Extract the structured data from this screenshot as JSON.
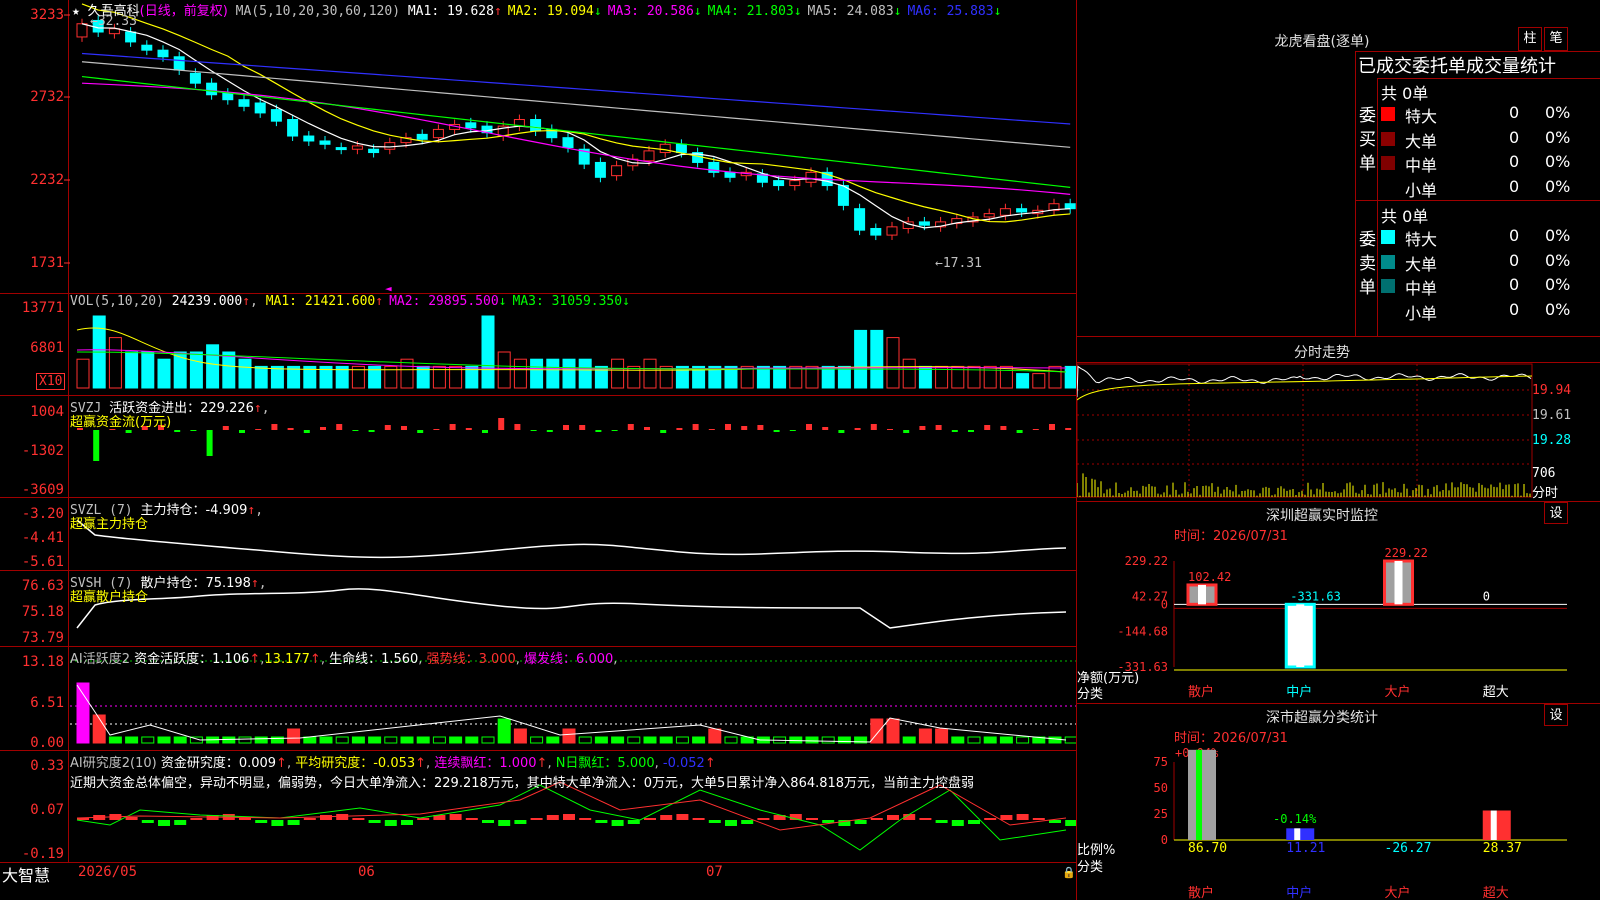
{
  "window": {
    "app_name": "大智慧"
  },
  "kline": {
    "stock_name": "久吾高科",
    "period": "(日线，前复权)",
    "ma_label": "MA(5,10,20,30,60,120)",
    "ma": [
      {
        "name": "MA1",
        "value": "19.628",
        "arrow": "↑",
        "color": "#ffffff"
      },
      {
        "name": "MA2",
        "value": "19.094",
        "arrow": "↓",
        "color": "#ffff00"
      },
      {
        "name": "MA3",
        "value": "20.586",
        "arrow": "↓",
        "color": "#ff00ff"
      },
      {
        "name": "MA4",
        "value": "21.803",
        "arrow": "↓",
        "color": "#00ff00"
      },
      {
        "name": "MA5",
        "value": "24.083",
        "arrow": "↓",
        "color": "#c0c0c0"
      },
      {
        "name": "MA6",
        "value": "25.883",
        "arrow": "↓",
        "color": "#3030ff"
      }
    ],
    "y_ticks": [
      "3233",
      "2732",
      "2232",
      "1731"
    ],
    "high_mark": "32.33",
    "low_mark": "←17.31"
  },
  "volume": {
    "label": "VOL(5,10,20)",
    "value": "24239.000",
    "ma": [
      {
        "name": "MA1",
        "value": "21421.600",
        "arrow": "↑",
        "color": "#ffff00"
      },
      {
        "name": "MA2",
        "value": "29895.500",
        "arrow": "↓",
        "color": "#ff00ff"
      },
      {
        "name": "MA3",
        "value": "31059.350",
        "arrow": "↓",
        "color": "#00ff00"
      }
    ],
    "y_ticks": [
      "13771",
      "6801"
    ],
    "unit": "X10"
  },
  "svzj": {
    "label": "SVZJ",
    "text": "活跃资金进出：229.226",
    "sub": "超赢资金流(万元)",
    "y_ticks": [
      "1004",
      "-1302",
      "-3609"
    ]
  },
  "svzl": {
    "label": "SVZL (7)",
    "text": "主力持仓：-4.909",
    "sub": "超赢主力持仓",
    "y_ticks": [
      "-3.20",
      "-4.41",
      "-5.61"
    ]
  },
  "svsh": {
    "label": "SVSH (7)",
    "text": "散户持仓：75.198",
    "sub": "超赢散户持仓",
    "y_ticks": [
      "76.63",
      "75.18",
      "73.79"
    ]
  },
  "ai1": {
    "label": "AI活跃度2",
    "text": "资金活跃度：1.106",
    "v2": "13.177",
    "life": "生命线：1.560",
    "strong": "强势线：3.000",
    "burst": "爆发线：6.000",
    "y_ticks": [
      "13.18",
      "6.51",
      "0.00"
    ]
  },
  "ai2": {
    "label": "AI研究度2(10)",
    "text": "资金研究度：0.009",
    "avg": "平均研究度：-0.053",
    "cont": "连续飘红：1.000",
    "nday": "N日飘红：5.000",
    "last": "-0.052",
    "comment": "近期大资金总体偏空，异动不明显，偏弱势，今日大单净流入：229.218万元，其中特大单净流入：0万元，大单5日累计净入864.818万元，当前主力控盘弱",
    "y_ticks": [
      "0.33",
      "0.07",
      "-0.19"
    ]
  },
  "x_axis": [
    "2026/05",
    "06",
    "07"
  ],
  "right": {
    "longhu": {
      "title": "龙虎看盘(逐单)",
      "btn1": "柱",
      "btn2": "笔",
      "header": "已成交委托单成交量统计",
      "buy_label": "委买单",
      "sell_label": "委卖单",
      "buy_total": "共 0单",
      "sell_total": "共 0单",
      "rows_buy": [
        {
          "name": "特大",
          "count": "0",
          "pct": "0%",
          "color": "#ff0000"
        },
        {
          "name": "大单",
          "count": "0",
          "pct": "0%",
          "color": "#8b0000"
        },
        {
          "name": "中单",
          "count": "0",
          "pct": "0%",
          "color": "#800000"
        },
        {
          "name": "小单",
          "count": "0",
          "pct": "0%",
          "color": "#000000"
        }
      ],
      "rows_sell": [
        {
          "name": "特大",
          "count": "0",
          "pct": "0%",
          "color": "#00ffff"
        },
        {
          "name": "大单",
          "count": "0",
          "pct": "0%",
          "color": "#008b8b"
        },
        {
          "name": "中单",
          "count": "0",
          "pct": "0%",
          "color": "#007070"
        },
        {
          "name": "小单",
          "count": "0",
          "pct": "0%",
          "color": "#000000"
        }
      ]
    },
    "fenshi": {
      "title": "分时走势",
      "y1": "19.94",
      "y2": "19.61",
      "y3": "19.28",
      "vol": "706",
      "vol_label": "分时"
    },
    "monitor": {
      "title": "深圳超赢实时监控",
      "btn": "设",
      "time": "时间：2026/07/31",
      "y_ticks": [
        "229.22",
        "42.27",
        "0",
        "-144.68",
        "-331.63"
      ],
      "ylabel": "净额(万元)",
      "xlabel": "分类",
      "bars": [
        {
          "cat": "散户",
          "value": 102.42,
          "label": "102.42"
        },
        {
          "cat": "中户",
          "value": -331.63,
          "label": "-331.63"
        },
        {
          "cat": "大户",
          "value": 229.22,
          "label": "229.22"
        },
        {
          "cat": "超大",
          "value": 0,
          "label": "0"
        }
      ]
    },
    "classify": {
      "title": "深市超赢分类统计",
      "btn": "设",
      "time": "时间：2026/07/31",
      "y_ticks": [
        "75",
        "50",
        "25",
        "0"
      ],
      "ylabel": "比例%",
      "xlabel": "分类",
      "top_label1": "+0.04%",
      "top_label2": "-0.14%",
      "bars": [
        {
          "cat": "散户",
          "value": 86.7,
          "label": "86.70"
        },
        {
          "cat": "中户",
          "value": 11.21,
          "label": "11.21"
        },
        {
          "cat": "大户",
          "value": -26.27,
          "label": "-26.27"
        },
        {
          "cat": "超大",
          "value": 28.37,
          "label": "28.37"
        }
      ]
    }
  },
  "chart_data": [
    {
      "type": "bar",
      "title": "深圳超赢实时监控",
      "categories": [
        "散户",
        "中户",
        "大户",
        "超大"
      ],
      "values": [
        102.42,
        -331.63,
        229.22,
        0
      ],
      "ylabel": "净额(万元)",
      "xlabel": "分类",
      "ylim": [
        -331.63,
        229.22
      ]
    },
    {
      "type": "bar",
      "title": "深市超赢分类统计",
      "categories": [
        "散户",
        "中户",
        "大户",
        "超大"
      ],
      "values": [
        86.7,
        11.21,
        -26.27,
        28.37
      ],
      "ylabel": "比例%",
      "xlabel": "分类",
      "ylim": [
        0,
        75
      ]
    }
  ]
}
